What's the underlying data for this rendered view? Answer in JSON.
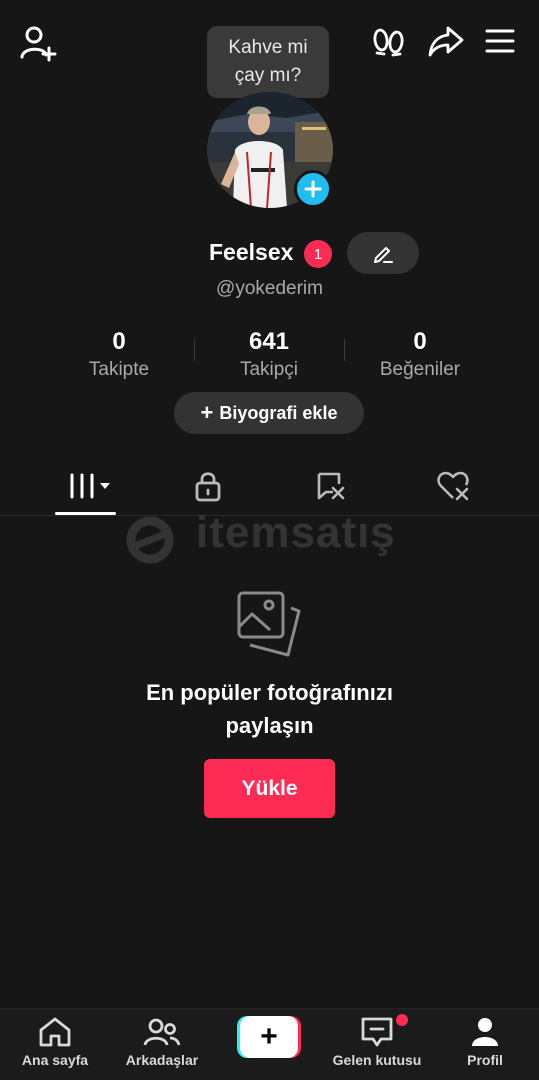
{
  "header": {
    "status_bubble": "Kahve mi\nçay mı?"
  },
  "profile": {
    "display_name": "Feelsex",
    "name_badge_count": "1",
    "username": "@yokederim"
  },
  "stats": [
    {
      "value": "0",
      "label": "Takipte"
    },
    {
      "value": "641",
      "label": "Takipçi"
    },
    {
      "value": "0",
      "label": "Beğeniler"
    }
  ],
  "bio_button": {
    "icon": "+",
    "label": "Biyografi ekle"
  },
  "tabs": [
    {
      "icon": "grid-icon",
      "active": true
    },
    {
      "icon": "lock-icon",
      "active": false
    },
    {
      "icon": "tagged-icon",
      "active": false
    },
    {
      "icon": "liked-icon",
      "active": false
    }
  ],
  "watermark": {
    "text": "itemsatış"
  },
  "empty_state": {
    "title": "En popüler fotoğrafınızı\npaylaşın",
    "button_label": "Yükle"
  },
  "bottom_nav": {
    "home": "Ana sayfa",
    "friends": "Arkadaşlar",
    "create": "+",
    "inbox": "Gelen kutusu",
    "profile": "Profil"
  },
  "colors": {
    "background": "#161616",
    "accent": "#fe2c55",
    "avatar_add": "#20bdf0",
    "secondary_text": "#a9a9a9"
  }
}
